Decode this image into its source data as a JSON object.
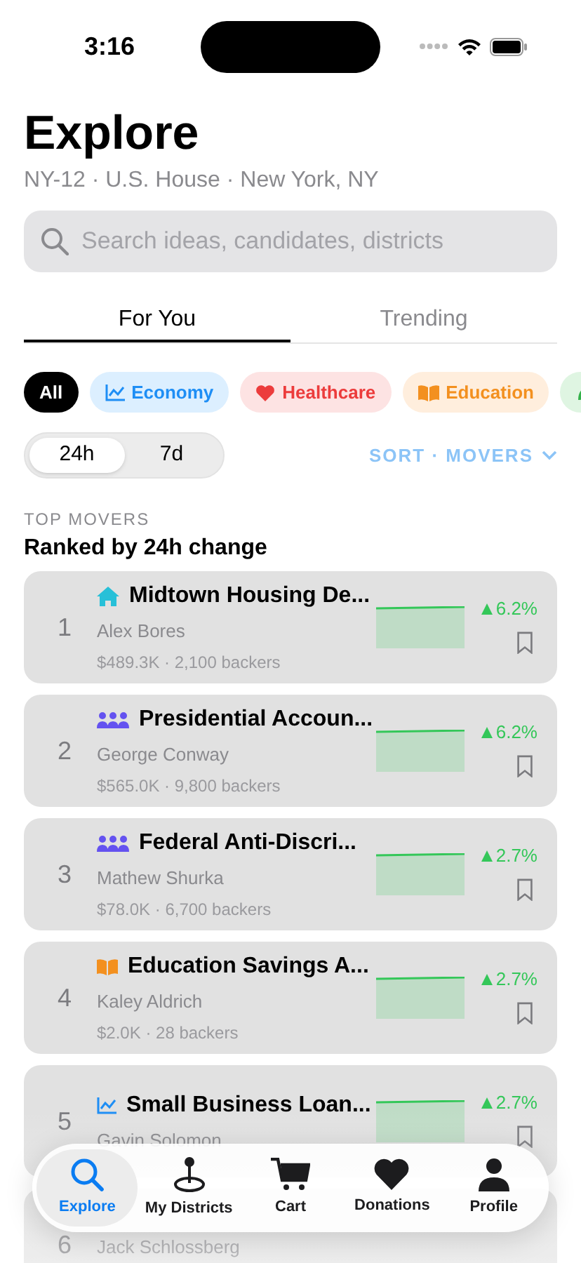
{
  "status_bar": {
    "time": "3:16"
  },
  "header": {
    "title": "Explore",
    "subtitle": "NY-12 · U.S. House · New York, NY"
  },
  "search": {
    "placeholder": "Search ideas, candidates, districts"
  },
  "tabs": [
    {
      "label": "For You",
      "selected": true
    },
    {
      "label": "Trending",
      "selected": false
    }
  ],
  "chips": [
    {
      "label": "All",
      "kind": "all",
      "selected": true
    },
    {
      "label": "Economy",
      "kind": "economy",
      "selected": false
    },
    {
      "label": "Healthcare",
      "kind": "healthcare",
      "selected": false
    },
    {
      "label": "Education",
      "kind": "education",
      "selected": false
    },
    {
      "kind": "environment",
      "selected": false
    }
  ],
  "period": [
    {
      "label": "24h",
      "selected": true
    },
    {
      "label": "7d",
      "selected": false
    }
  ],
  "sort": {
    "label": "SORT · MOVERS"
  },
  "section": {
    "eyebrow": "TOP MOVERS",
    "title": "Ranked by 24h change"
  },
  "rows": [
    {
      "rank": "1",
      "kind": "housing",
      "title": "Midtown Housing De...",
      "name": "Alex Bores",
      "meta": "$489.3K · 2,100 backers",
      "change": "6.2%"
    },
    {
      "rank": "2",
      "kind": "people",
      "title": "Presidential Accoun...",
      "name": "George Conway",
      "meta": "$565.0K · 9,800 backers",
      "change": "6.2%"
    },
    {
      "rank": "3",
      "kind": "people",
      "title": "Federal Anti-Discri...",
      "name": "Mathew Shurka",
      "meta": "$78.0K · 6,700 backers",
      "change": "2.7%"
    },
    {
      "rank": "4",
      "kind": "education",
      "title": "Education Savings A...",
      "name": "Kaley Aldrich",
      "meta": "$2.0K · 28 backers",
      "change": "2.7%"
    },
    {
      "rank": "5",
      "kind": "economy",
      "title": "Small Business Loan...",
      "name": "Gavin Solomon",
      "change": "2.7%"
    },
    {
      "rank": "6",
      "name": "Jack Schlossberg"
    }
  ],
  "nav": [
    {
      "label": "Explore",
      "kind": "search",
      "selected": true
    },
    {
      "label": "My Districts",
      "kind": "pin",
      "selected": false
    },
    {
      "label": "Cart",
      "kind": "cart",
      "selected": false
    },
    {
      "label": "Donations",
      "kind": "heart",
      "selected": false
    },
    {
      "label": "Profile",
      "kind": "person",
      "selected": false
    }
  ]
}
